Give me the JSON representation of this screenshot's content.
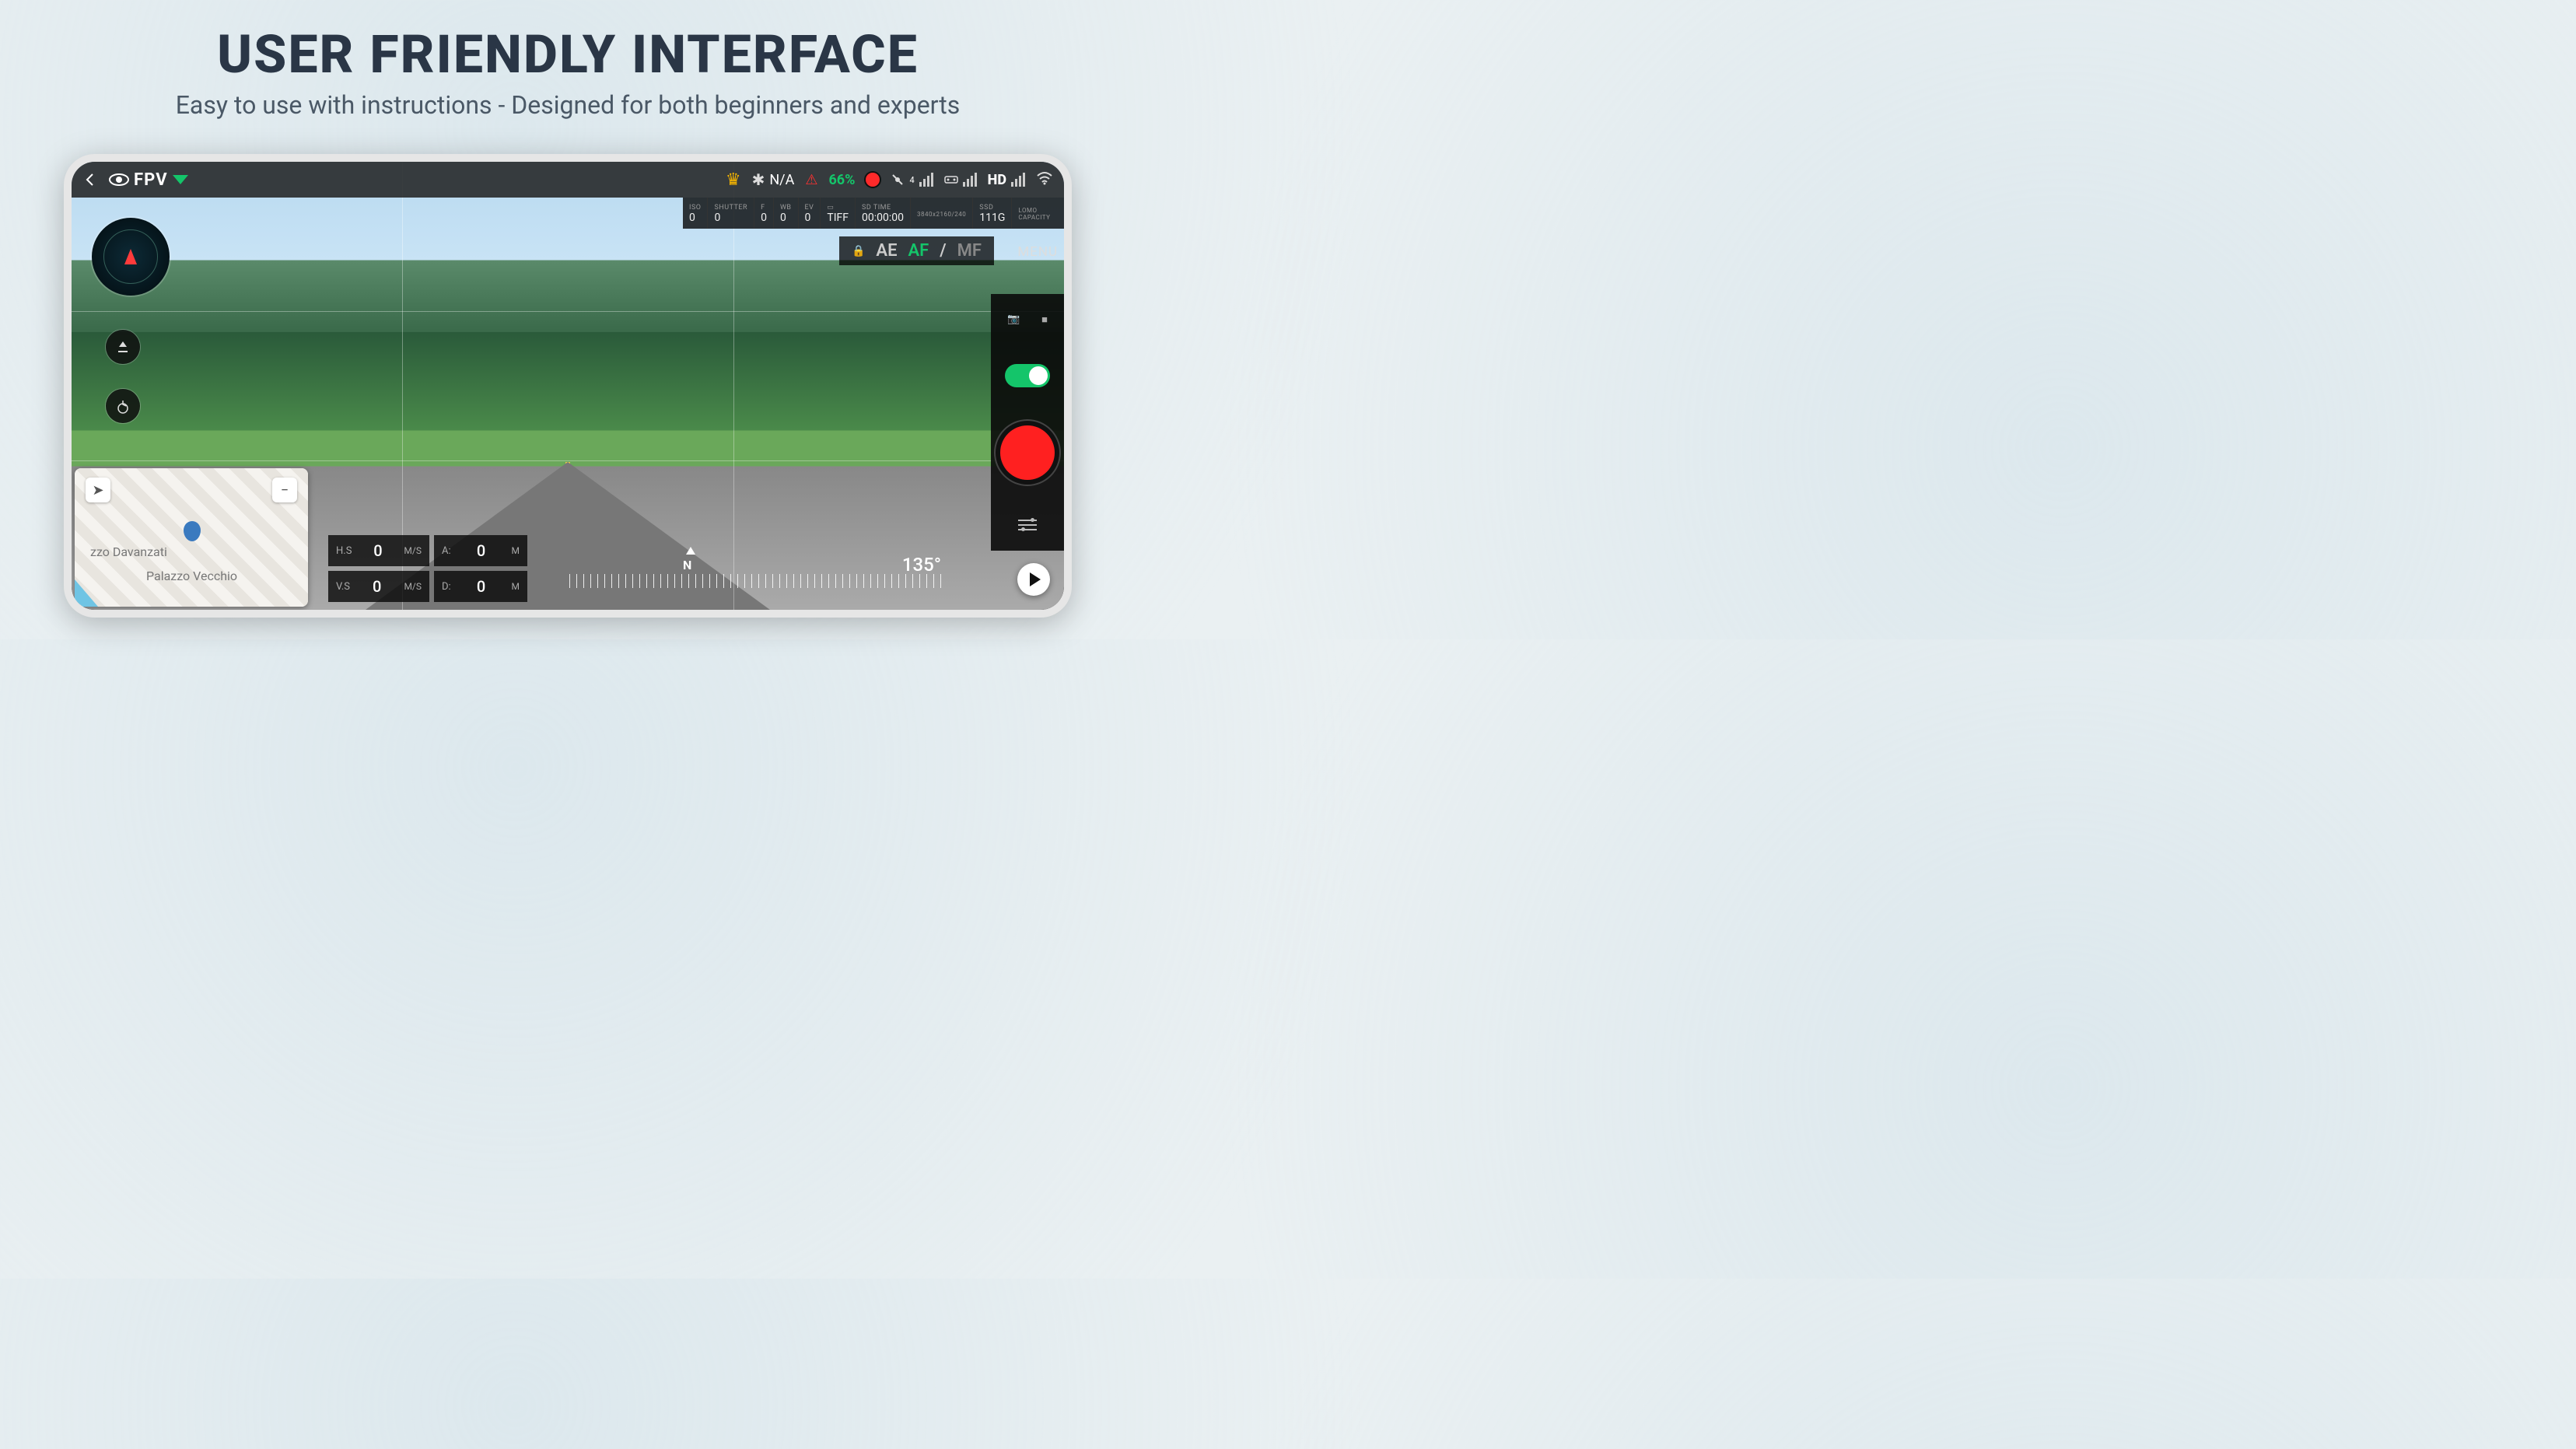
{
  "headline": {
    "title": "USER FRIENDLY INTERFACE",
    "subtitle": "Easy to use with instructions - Designed for both beginners and experts"
  },
  "topbar": {
    "mode": "FPV",
    "drone_status": "N/A",
    "battery": "66%",
    "gps_count": "4",
    "video_signal": "HD"
  },
  "params": {
    "iso_lbl": "ISO",
    "iso_val": "0",
    "shutter_lbl": "SHUTTER",
    "shutter_val": "0",
    "f_lbl": "F",
    "f_val": "0",
    "wb_lbl": "WB",
    "wb_val": "0",
    "ev_lbl": "EV",
    "ev_val": "0",
    "format": "TIFF",
    "sd_lbl": "SD TIME",
    "sd_val": "00:00:00",
    "res": "3840x2160/240",
    "ssd_lbl": "SSD",
    "ssd_val": "111G",
    "lomo_lbl": "LOMO CAPACITY"
  },
  "focus": {
    "ae": "AE",
    "af": "AF",
    "sep": "/",
    "mf": "MF"
  },
  "menu": "MENU",
  "telemetry": {
    "hs_lbl": "H.S",
    "hs_val": "0",
    "hs_unit": "M/S",
    "a_lbl": "A:",
    "a_val": "0",
    "a_unit": "M",
    "vs_lbl": "V.S",
    "vs_val": "0",
    "vs_unit": "M/S",
    "d_lbl": "D:",
    "d_val": "0",
    "d_unit": "M"
  },
  "compass": {
    "n": "N",
    "heading": "135°"
  },
  "minimap": {
    "place_a": "zzo Davanzati",
    "place_b": "Palazzo Vecchio"
  }
}
